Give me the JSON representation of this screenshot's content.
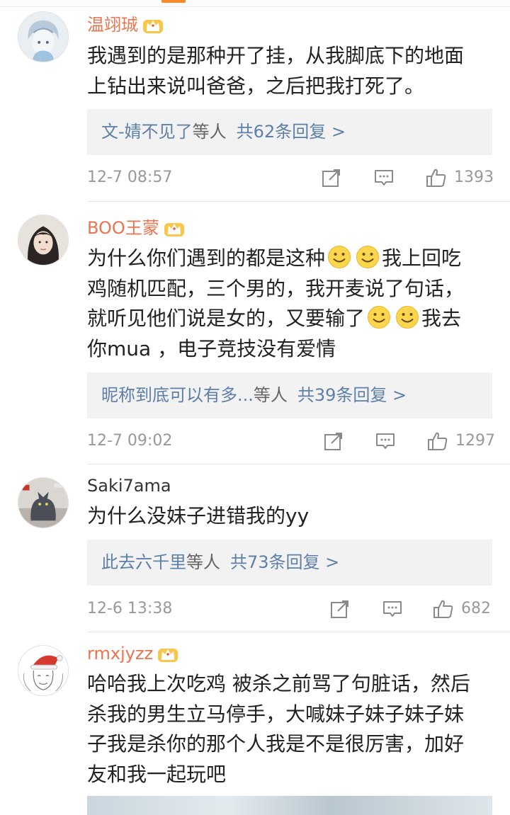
{
  "comments": [
    {
      "username": "温翊珹",
      "vip": true,
      "avatar_icon": "anime-avatar",
      "lines": [
        "我遇到的是那种开了挂，从我脚底下的地面",
        "上钻出来说叫爸爸，之后把我打死了。"
      ],
      "reply": {
        "who": "文-婧不见了",
        "etc": "等人",
        "count": "共62条回复 >"
      },
      "time": "12-7 08:57",
      "likes": "1393"
    },
    {
      "username": "BOO王蒙",
      "vip": true,
      "avatar_icon": "girl-photo-avatar",
      "lines_parts": [
        {
          "a": "为什么你们遇到的都是这种",
          "b": "我上回吃"
        },
        {
          "a": "鸡随机匹配，三个男的，我开麦说了句话，"
        },
        {
          "a": "就听见他们说是女的，又要输了",
          "b": "我去"
        },
        {
          "a": "你mua ，电子竞技没有爱情"
        }
      ],
      "reply": {
        "who": "昵称到底可以有多...",
        "etc": "等人",
        "count": "共39条回复 >"
      },
      "time": "12-7 09:02",
      "likes": "1297"
    },
    {
      "username": "Saki7ama",
      "vip": false,
      "avatar_icon": "cat-photo-avatar",
      "lines": [
        "为什么没妹子进错我的yy"
      ],
      "reply": {
        "who": "此去六千里",
        "etc": "等人",
        "count": "共73条回复 >"
      },
      "time": "12-6 13:38",
      "likes": "682"
    },
    {
      "username": "rmxjyzz",
      "vip": true,
      "avatar_icon": "sketch-santa-avatar",
      "lines": [
        "哈哈我上次吃鸡 被杀之前骂了句脏话，然后",
        "杀我的男生立马停手，大喊妹子妹子妹子妹",
        "子我是杀你的那个人我是不是很厉害，加好",
        "友和我一起玩吧"
      ]
    }
  ],
  "icons": {
    "vip": "crown-icon",
    "repost": "repost-icon",
    "comment": "comment-icon",
    "like": "thumbs-up-icon",
    "emoji": "smile-emoji-icon"
  },
  "colors": {
    "vip_name": "#eb7350",
    "link": "#5d7fa8",
    "meta": "#999999",
    "reply_bg": "#f2f2f2"
  }
}
